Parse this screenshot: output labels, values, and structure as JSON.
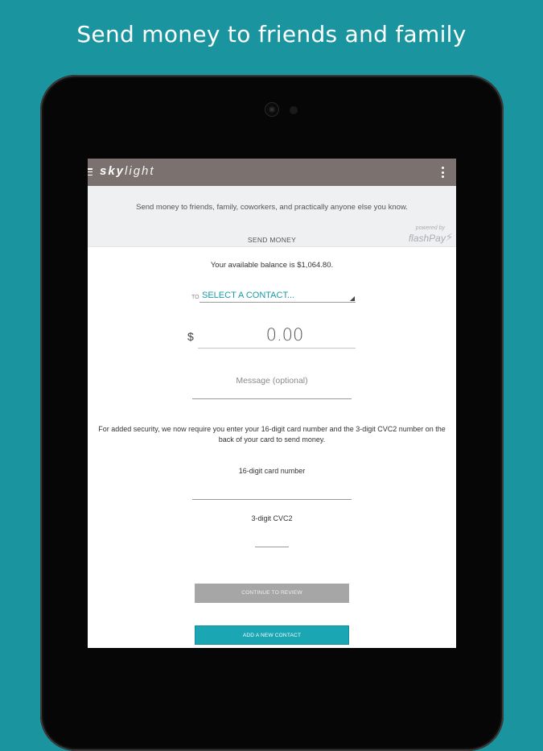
{
  "headline": "Send money to friends and family",
  "app": {
    "logo_bold": "sky",
    "logo_light": "light"
  },
  "banner": {
    "description": "Send money to friends, family, coworkers, and practically anyone else you know.",
    "tab_label": "SEND MONEY",
    "powered_by": "powered by",
    "powered_brand": "flashPay"
  },
  "form": {
    "balance_text": "Your available balance is $1,064.80.",
    "to_label": "TO",
    "contact_placeholder": "SELECT A CONTACT...",
    "currency_symbol": "$",
    "amount_value": "0.00",
    "message_placeholder": "Message (optional)",
    "security_text": "For added security, we now require you enter your 16-digit card number and the 3-digit CVC2 number on the back of your card to send money.",
    "card_number_label": "16-digit card number",
    "cvc_label": "3-digit CVC2",
    "continue_button": "CONTINUE TO REVIEW",
    "add_contact_button": "ADD A NEW CONTACT"
  },
  "colors": {
    "background": "#1a959f",
    "appbar": "#7b726f",
    "accent": "#1ba6b4",
    "disabled_button": "#a6a6a6"
  },
  "icons": [
    "hamburger-menu-icon",
    "overflow-menu-icon",
    "dropdown-triangle-icon",
    "lightning-bolt-icon"
  ]
}
